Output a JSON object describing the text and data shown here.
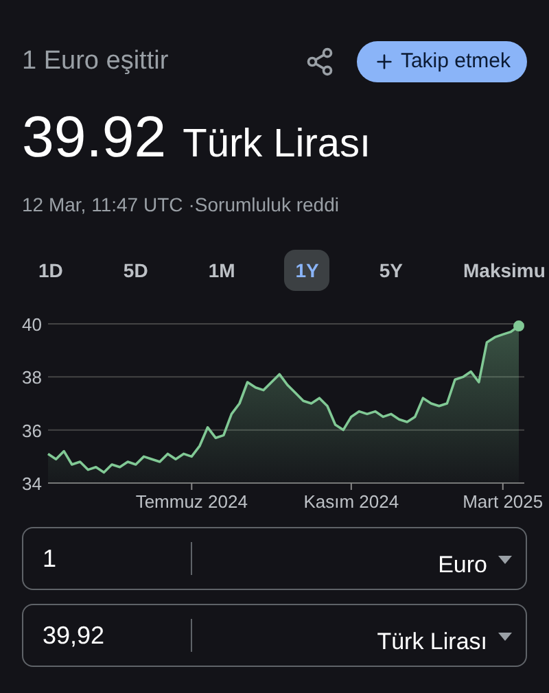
{
  "header": {
    "subtitle": "1 Euro eşittir",
    "follow_button": "Takip etmek"
  },
  "rate": {
    "value": "39.92",
    "currency": "Türk Lirası"
  },
  "timestamp": "12 Mar, 11:47 UTC",
  "disclaimer": "·Sorumluluk reddi",
  "ranges": [
    {
      "label": "1D",
      "selected": false
    },
    {
      "label": "5D",
      "selected": false
    },
    {
      "label": "1M",
      "selected": false
    },
    {
      "label": "1Y",
      "selected": true
    },
    {
      "label": "5Y",
      "selected": false
    },
    {
      "label": "Maksimu",
      "selected": false
    }
  ],
  "chart_data": {
    "type": "area",
    "ylim": [
      34,
      40
    ],
    "yticks": [
      34,
      36,
      38,
      40
    ],
    "categories": [
      null,
      null,
      null,
      null,
      null,
      null,
      null,
      null,
      null,
      null,
      null,
      null,
      null,
      null,
      null,
      null,
      null,
      null,
      "Temmuz 2024",
      null,
      null,
      null,
      null,
      null,
      null,
      null,
      null,
      null,
      null,
      null,
      null,
      null,
      null,
      null,
      null,
      null,
      null,
      null,
      "Kasım 2024",
      null,
      null,
      null,
      null,
      null,
      null,
      null,
      null,
      null,
      null,
      null,
      null,
      null,
      null,
      null,
      null,
      null,
      null,
      "Mart 2025",
      null,
      null
    ],
    "series": [
      {
        "color": "#81c995",
        "values": [
          35.1,
          34.9,
          35.2,
          34.7,
          34.8,
          34.5,
          34.6,
          34.4,
          34.7,
          34.6,
          34.8,
          34.7,
          35.0,
          34.9,
          34.8,
          35.1,
          34.9,
          35.1,
          35.0,
          35.4,
          36.1,
          35.7,
          35.8,
          36.6,
          37.0,
          37.8,
          37.6,
          37.5,
          37.8,
          38.1,
          37.7,
          37.4,
          37.1,
          37.0,
          37.2,
          36.9,
          36.2,
          36.0,
          36.5,
          36.7,
          36.6,
          36.7,
          36.5,
          36.6,
          36.4,
          36.3,
          36.5,
          37.2,
          37.0,
          36.9,
          37.0,
          37.9,
          38.0,
          38.2,
          37.8,
          39.3,
          39.5,
          39.6,
          39.7,
          39.92
        ]
      }
    ]
  },
  "converter": [
    {
      "value": "1",
      "currency": "Euro"
    },
    {
      "value": "39,92",
      "currency": "Türk Lirası"
    }
  ]
}
